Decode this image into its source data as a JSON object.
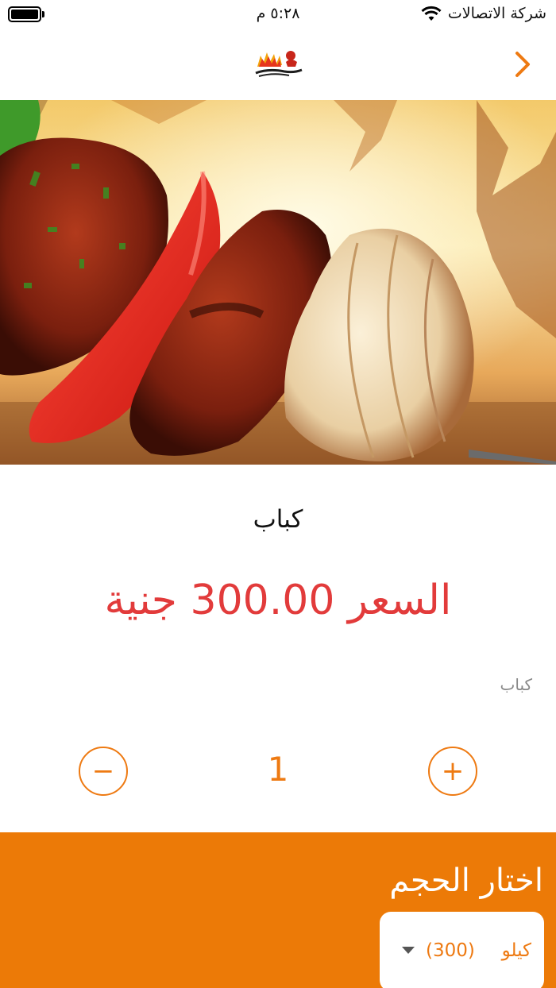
{
  "status_bar": {
    "carrier": "شركة الاتصالات",
    "time": "٥:٢٨ م"
  },
  "nav": {
    "logo_alt": "فرسي الكبابجي",
    "icons": [
      "back-chevron-icon"
    ]
  },
  "product": {
    "name": "كباب",
    "price_label": "السعر",
    "price_value": "300.00",
    "currency": "جنية",
    "description": "كباب"
  },
  "quantity": {
    "value": "1",
    "plus_label": "+",
    "minus_label": "−"
  },
  "size": {
    "heading": "اختار الحجم",
    "selected_unit": "كيلو",
    "selected_amount": "(300)"
  },
  "colors": {
    "accent": "#ec7a07",
    "price": "#e23b3b"
  }
}
